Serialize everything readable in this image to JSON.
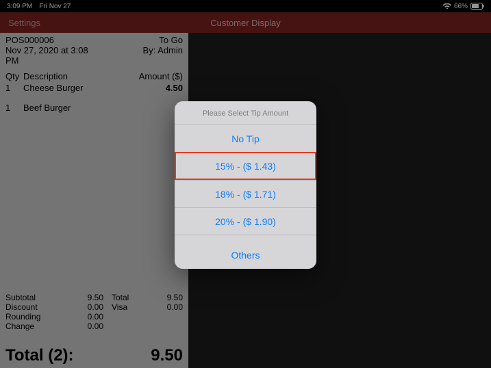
{
  "status": {
    "time": "3:09 PM",
    "date": "Fri Nov 27",
    "battery": "66%"
  },
  "nav": {
    "left": "Settings",
    "title": "Customer Display"
  },
  "receipt": {
    "order_id": "POS000006",
    "to_go": "To Go",
    "timestamp": "Nov 27, 2020 at 3:08 PM",
    "by": "By: Admin",
    "headers": {
      "qty": "Qty",
      "desc": "Description",
      "amount": "Amount ($)"
    },
    "items": [
      {
        "qty": "1",
        "desc": "Cheese Burger",
        "amount": "4.50"
      },
      {
        "qty": "1",
        "desc": "Beef Burger",
        "amount": "5."
      }
    ],
    "totals_left": [
      {
        "label": "Subtotal",
        "value": "9.50"
      },
      {
        "label": "Discount",
        "value": "0.00"
      },
      {
        "label": "Rounding",
        "value": "0.00"
      },
      {
        "label": "Change",
        "value": "0.00"
      }
    ],
    "totals_right": [
      {
        "label": "Total",
        "value": "9.50"
      },
      {
        "label": "Visa",
        "value": "0.00"
      }
    ],
    "grand_label": "Total (2):",
    "grand_value": "9.50"
  },
  "dialog": {
    "title": "Please Select Tip Amount",
    "options": [
      {
        "label": "No Tip",
        "selected": false
      },
      {
        "label": "15% - ($ 1.43)",
        "selected": true
      },
      {
        "label": "18% - ($ 1.71)",
        "selected": false
      },
      {
        "label": "20% - ($ 1.90)",
        "selected": false
      }
    ],
    "others": "Others"
  }
}
